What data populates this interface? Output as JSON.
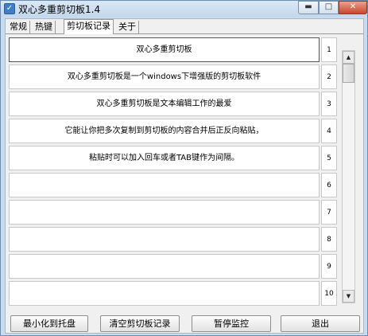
{
  "window": {
    "title": "双心多重剪切板1.4",
    "icon": "app-icon"
  },
  "window_controls": {
    "minimize": "▬",
    "maximize": "□",
    "close": "✕"
  },
  "tabs": [
    {
      "label": "常规",
      "active": false
    },
    {
      "label": "热键",
      "active": false
    },
    {
      "label": "剪切板记录",
      "active": true
    },
    {
      "label": "关于",
      "active": false
    }
  ],
  "list": {
    "rows": [
      {
        "number": "1",
        "text": "双心多重剪切板"
      },
      {
        "number": "2",
        "text": "双心多重剪切板是一个windows下增强版的剪切板软件"
      },
      {
        "number": "3",
        "text": "双心多重剪切板是文本编辑工作的最爱"
      },
      {
        "number": "4",
        "text": "它能让你把多次复制到剪切板的内容合并后正反向粘贴，"
      },
      {
        "number": "5",
        "text": "粘贴时可以加入回车或者TAB键作为间隔。"
      },
      {
        "number": "6",
        "text": ""
      },
      {
        "number": "7",
        "text": ""
      },
      {
        "number": "8",
        "text": ""
      },
      {
        "number": "9",
        "text": ""
      },
      {
        "number": "10",
        "text": ""
      }
    ]
  },
  "scrollbar": {
    "up": "▲",
    "down": "▼"
  },
  "buttons": {
    "minimize_tray": "最小化到托盘",
    "clear_clipboard": "清空剪切板记录",
    "pause_monitor": "暂停监控",
    "exit": "退出"
  }
}
